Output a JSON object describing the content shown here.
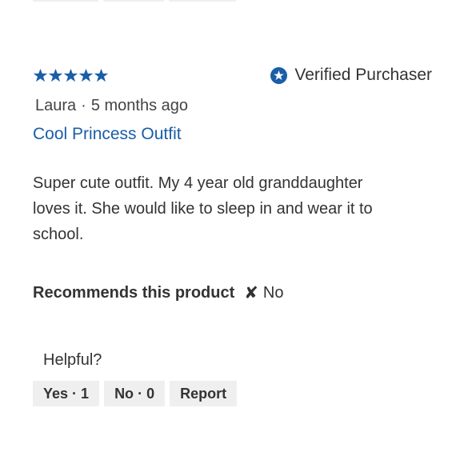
{
  "review": {
    "rating": 5,
    "max_rating": 5,
    "star_color": "#1a5ea8",
    "verified_label": "Verified Purchaser",
    "author": "Laura",
    "separator": "·",
    "date": "5 months ago",
    "title": "Cool Princess Outfit",
    "body": "Super cute outfit. My 4 year old granddaughter loves it. She would like to sleep in and wear it to school.",
    "recommends_label": "Recommends this product",
    "recommends_icon": "x-mark-icon",
    "recommends_value": "No"
  },
  "feedback": {
    "helpful_label": "Helpful?",
    "yes_label": "Yes",
    "yes_count": "1",
    "no_label": "No",
    "no_count": "0",
    "separator": "·",
    "report_label": "Report"
  }
}
